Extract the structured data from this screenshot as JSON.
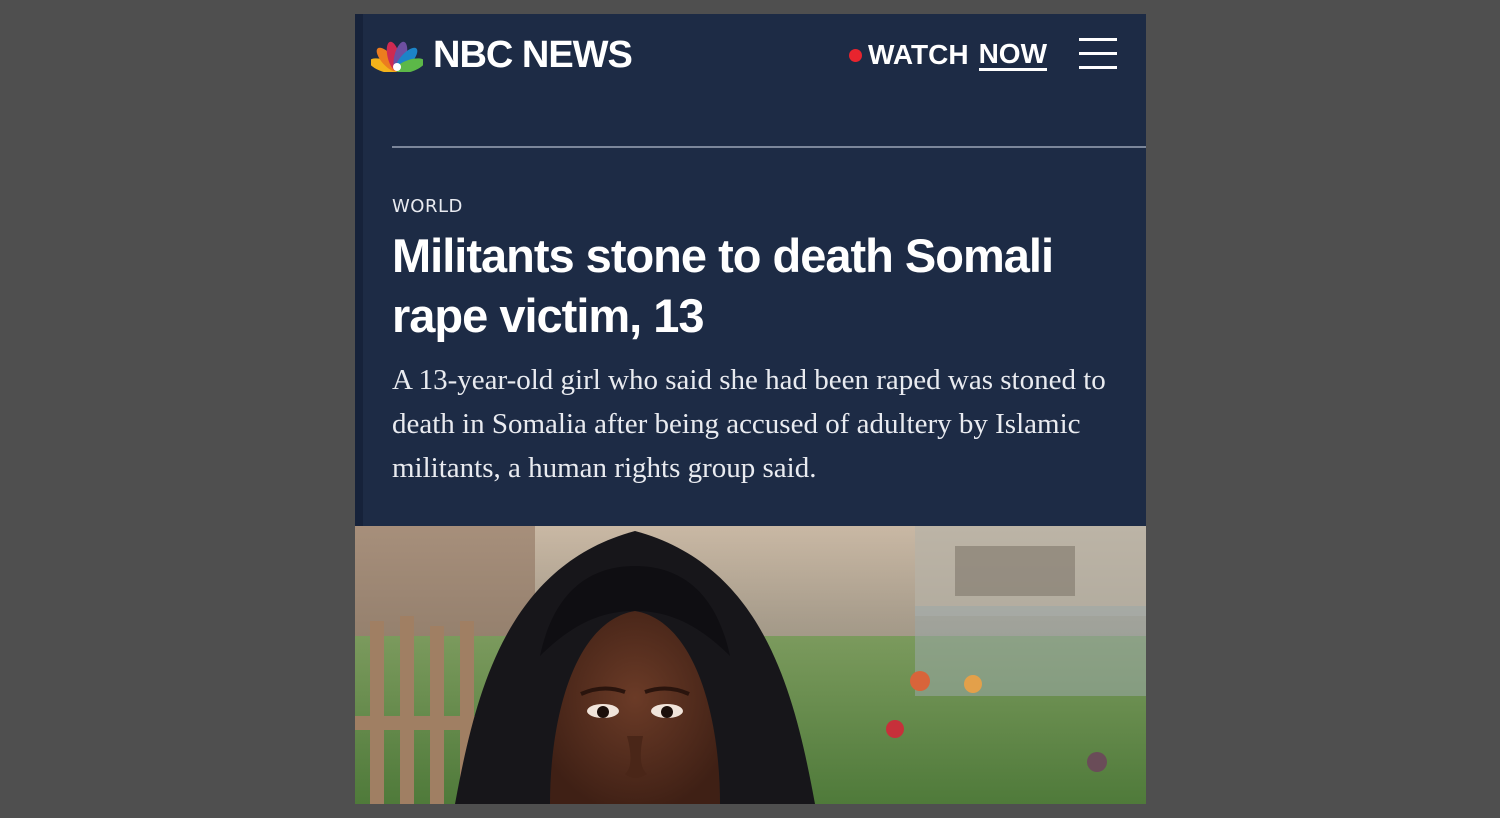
{
  "header": {
    "logo_text": "NBC NEWS",
    "logo_icon": "peacock-icon",
    "watch_label": "WATCH",
    "watch_now": "NOW",
    "live_icon": "live-dot-icon",
    "menu_icon": "hamburger-menu-icon"
  },
  "article": {
    "section": "WORLD",
    "headline": "Militants stone to death Somali rape victim, 13",
    "dek": "A 13-year-old girl who said she had been raped was stoned to death in Somalia after being accused of adultery by Islamic militants, a human rights group said."
  },
  "colors": {
    "background": "#1d2b45",
    "live_dot": "#e8242e",
    "page_surround": "#4f4f4f"
  }
}
